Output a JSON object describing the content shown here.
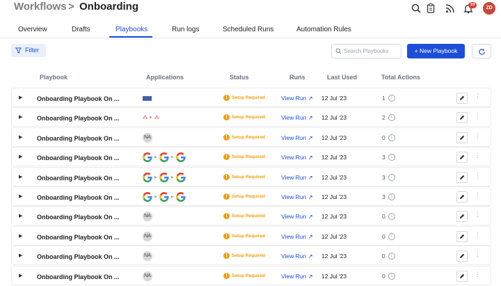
{
  "header": {
    "crumb_root": "Workflows",
    "crumb_sep": ">",
    "crumb_current": "Onboarding",
    "notification_count": "10",
    "avatar_initials": "ZD"
  },
  "tabs": [
    "Overview",
    "Drafts",
    "Playbooks",
    "Run logs",
    "Scheduled Runs",
    "Automation Rules"
  ],
  "active_tab": "Playbooks",
  "toolbar": {
    "filter_label": "Filter",
    "search_placeholder": "Search Playbooks",
    "new_button": "+ New Playbook"
  },
  "columns": [
    "Playbook",
    "Applications",
    "Status",
    "Runs",
    "Last Used",
    "Total Actions"
  ],
  "rows": [
    {
      "name": "Onboarding Playbook On ...",
      "apps": "bars",
      "status": "Setup Required",
      "runs": "View Run ↗",
      "last_used": "12 Jul '23",
      "total": "1"
    },
    {
      "name": "Onboarding Playbook On ...",
      "apps": "red",
      "status": "Setup Required",
      "runs": "View Run ↗",
      "last_used": "12 Jul '23",
      "total": "2"
    },
    {
      "name": "Onboarding Playbook On ...",
      "apps": "na",
      "status": "Setup Required",
      "runs": "View Run ↗",
      "last_used": "12 Jul '23",
      "total": "0"
    },
    {
      "name": "Onboarding Playbook On ...",
      "apps": "google",
      "status": "Setup Required",
      "runs": "View Run ↗",
      "last_used": "12 Jul '23",
      "total": "3"
    },
    {
      "name": "Onboarding Playbook On ...",
      "apps": "google",
      "status": "Setup Required",
      "runs": "View Run ↗",
      "last_used": "12 Jul '23",
      "total": "3"
    },
    {
      "name": "Onboarding Playbook On ...",
      "apps": "google",
      "status": "Setup Required",
      "runs": "View Run ↗",
      "last_used": "12 Jul '23",
      "total": "3"
    },
    {
      "name": "Onboarding Playbook On ...",
      "apps": "na",
      "status": "Setup Required",
      "runs": "View Run ↗",
      "last_used": "12 Jul '23",
      "total": "0"
    },
    {
      "name": "Onboarding Playbook On ...",
      "apps": "na",
      "status": "Setup Required",
      "runs": "View Run ↗",
      "last_used": "12 Jul '23",
      "total": "0"
    },
    {
      "name": "Onboarding Playbook On ...",
      "apps": "na",
      "status": "Setup Required",
      "runs": "View Run ↗",
      "last_used": "12 Jul '23",
      "total": "0"
    },
    {
      "name": "Onboarding Playbook On ...",
      "apps": "na",
      "status": "Setup Required",
      "runs": "View Run ↗",
      "last_used": "12 Jul '23",
      "total": "0"
    }
  ],
  "na_label": "NA",
  "icons": {
    "row_caret": "caret-right-icon",
    "status": "warning-circle-icon",
    "edit": "pencil-icon",
    "more": "kebab-icon",
    "info": "info-icon",
    "google": "google-icon"
  },
  "colors": {
    "accent": "#1d4ed8",
    "warning": "#f59e0b",
    "badge": "#e53935",
    "avatar": "#c8473b"
  }
}
